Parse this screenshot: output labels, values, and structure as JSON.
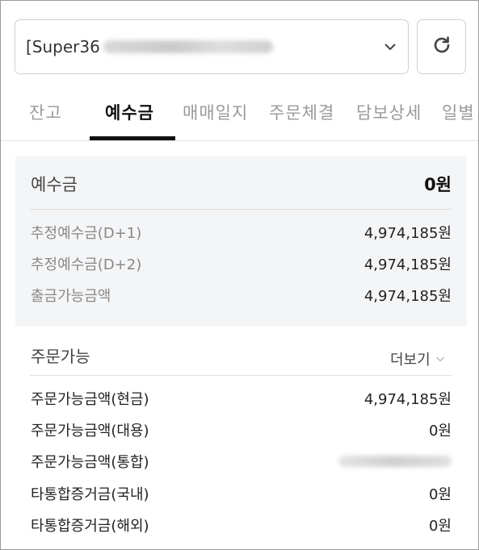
{
  "account": {
    "name_visible": "[Super36",
    "masked": true
  },
  "refresh": {
    "icon": "refresh-icon"
  },
  "tabs": [
    {
      "label": "잔고",
      "active": false
    },
    {
      "label": "예수금",
      "active": true
    },
    {
      "label": "매매일지",
      "active": false
    },
    {
      "label": "주문체결",
      "active": false
    },
    {
      "label": "담보상세",
      "active": false
    },
    {
      "label": "일별",
      "active": false
    }
  ],
  "deposit": {
    "title": "예수금",
    "total": "0원",
    "rows": [
      {
        "label": "추정예수금(D+1)",
        "value": "4,974,185원"
      },
      {
        "label": "추정예수금(D+2)",
        "value": "4,974,185원"
      },
      {
        "label": "출금가능금액",
        "value": "4,974,185원"
      }
    ]
  },
  "order": {
    "title": "주문가능",
    "more_label": "더보기",
    "rows": [
      {
        "label": "주문가능금액(현금)",
        "value": "4,974,185원",
        "masked": false
      },
      {
        "label": "주문가능금액(대용)",
        "value": "0원",
        "masked": false
      },
      {
        "label": "주문가능금액(통합)",
        "value": "",
        "masked": true
      },
      {
        "label": "타통합증거금(국내)",
        "value": "0원",
        "masked": false
      },
      {
        "label": "타통합증거금(해외)",
        "value": "0원",
        "masked": false
      }
    ]
  },
  "colors": {
    "panel_bg": "#f4f5f7",
    "active_tab": "#111111",
    "inactive_tab": "#9a9a9a",
    "muted_label": "#888888"
  }
}
